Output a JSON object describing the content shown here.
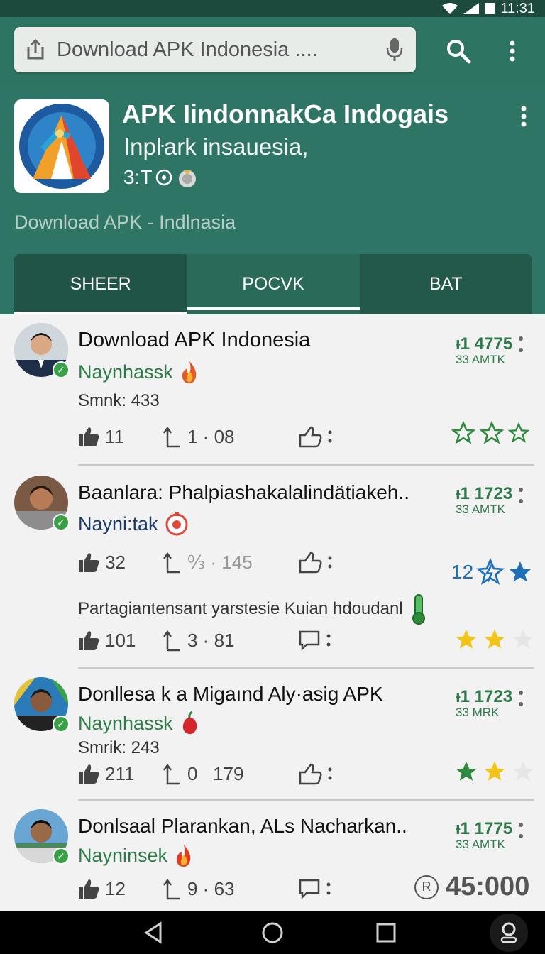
{
  "status_bar": {
    "time": "11:31"
  },
  "search": {
    "query": "Download APK Indonesia ....",
    "placeholder": "Download APK Indonesia ....",
    "icons": [
      "share-icon",
      "mic-icon",
      "search-icon",
      "more-vert-icon"
    ]
  },
  "app": {
    "title": "APK IindonnakCa Indogais",
    "subtitle": "Inpŀark insauesia,",
    "rating_text": "3:T",
    "caption": "Download APK - Indlnasia"
  },
  "tabs": [
    {
      "label": "SHEER"
    },
    {
      "label": "POCVK"
    },
    {
      "label": "BAT"
    }
  ],
  "posts": [
    {
      "title": "Download APK Indonesia",
      "author": "Naynhassk",
      "meta": "Smnk: 433",
      "likes": "11",
      "reposts": "1 · 08",
      "stat": "ᵻ1 4775",
      "stat_sub": "33 AMTK",
      "stars_filled": 0,
      "author_icon": "fire-icon"
    },
    {
      "title": "Baanlara: Phalpiashakalalindätiakeh..",
      "author": "Nayni:tak",
      "likes": "32",
      "reposts": "↉ · 145",
      "stat": "ᵻ1 1723",
      "stat_sub": "33 AMTK",
      "rating_value": "12",
      "comment": "Partagiantensant yarstesie Kuian hdoudanl",
      "likes2": "101",
      "reposts2": "3 · 81",
      "stars_filled": 2,
      "author_icon": "timer-icon"
    },
    {
      "title": "Donllesa k a Migaınd Aly·asig APK",
      "author": "Naynhassk",
      "meta": "Smrik: 243",
      "likes": "211",
      "reposts": "0   179",
      "stat": "ᵻ1 1723",
      "stat_sub": "33 MRK",
      "stars_filled": 2,
      "author_icon": "chili-icon"
    },
    {
      "title": "Donlsaal Plarankan, ALs Nacharkan..",
      "author": "Nayninsek",
      "likes": "12",
      "reposts": "9 · 63",
      "stat": "ᵻ1 1775",
      "stat_sub": "33 AMTK",
      "total": "45:000",
      "total_badge": "R",
      "author_icon": "fire-icon"
    }
  ],
  "colors": {
    "primary": "#2f7565",
    "dark": "#1c4b3d",
    "accent_green": "#2e7a4b",
    "star_gold": "#f2c418",
    "star_green": "#2e8a3c"
  }
}
